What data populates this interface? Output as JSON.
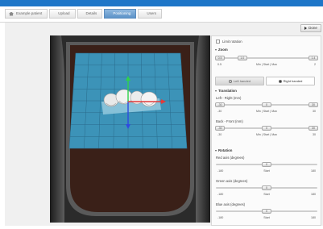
{
  "breadcrumb": [
    {
      "label": "Example patient",
      "active": false
    },
    {
      "label": "Upload",
      "active": false
    },
    {
      "label": "Details",
      "active": false
    },
    {
      "label": "Positioning",
      "active": true
    },
    {
      "label": "Users",
      "active": false
    }
  ],
  "toolbar": {
    "done_label": "Done"
  },
  "colors": {
    "accent": "#1e76c8",
    "active_tab": "#6b9dd0",
    "grid_plane": "#3c93b8",
    "background_shape": "#3a2018",
    "x_axis": "#e23b3b",
    "y_axis": "#2fd24a",
    "z_axis": "#2f4be0"
  },
  "panel": {
    "limit_rotation_label": "Limit rotation",
    "zoom": {
      "heading": "Zoom",
      "knob_left": "0.5",
      "knob_mid": "1.0",
      "knob_right": "1.4",
      "scale_min": "0.5",
      "scale_mid": "Min | Start | Max",
      "scale_max": "2",
      "left_hand_label": "Left handed",
      "right_hand_label": "Right handed",
      "hand_selected": "right"
    },
    "translation": {
      "heading": "Translation",
      "left_right_label": "Left - Right (mm)",
      "left_right": {
        "knob_min": "-30",
        "knob_start": "0",
        "knob_max": "30",
        "scale_min": "-30",
        "scale_mid": "Min | Start | Max",
        "scale_max": "30"
      },
      "back_front_label": "Back - Front (mm)",
      "back_front": {
        "knob_min": "-30",
        "knob_start": "0",
        "knob_max": "30",
        "scale_min": "-30",
        "scale_mid": "Min | Start | Max",
        "scale_max": "30"
      }
    },
    "rotation": {
      "heading": "Rotation",
      "red_label": "Red axis (degrees)",
      "green_label": "Green axis (degrees)",
      "blue_label": "Blue axis (degrees)",
      "knob": "0",
      "scale_min": "-180",
      "scale_mid": "Start",
      "scale_max": "180"
    }
  }
}
